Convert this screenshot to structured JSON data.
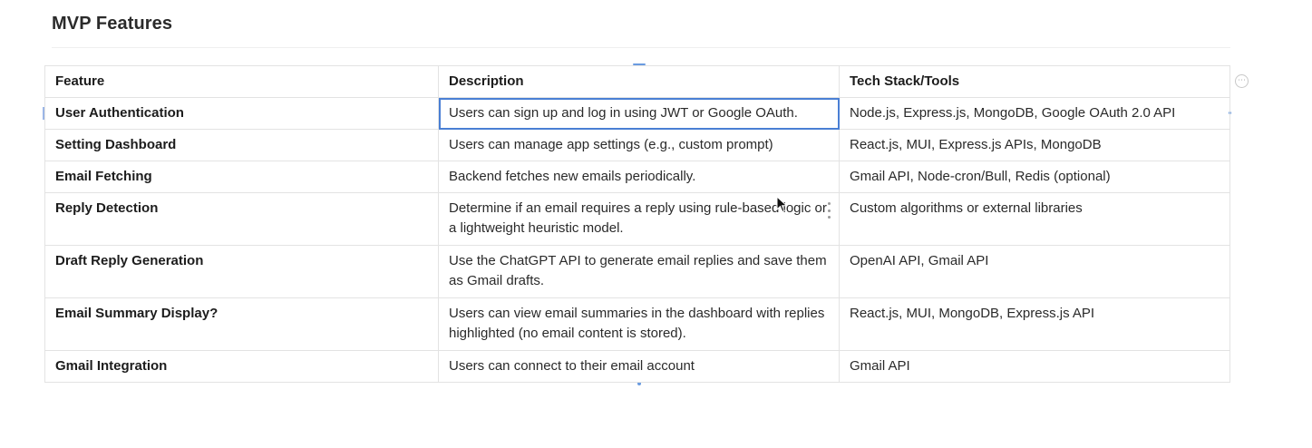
{
  "page": {
    "title": "MVP Features"
  },
  "table": {
    "headers": {
      "feature": "Feature",
      "description": "Description",
      "tech": "Tech Stack/Tools"
    },
    "rows": [
      {
        "feature": "User Authentication",
        "description": "Users can sign up and log in using JWT or Google OAuth.",
        "tech": "Node.js, Express.js, MongoDB, Google OAuth 2.0 API"
      },
      {
        "feature": "Setting Dashboard",
        "description": "Users can manage app settings (e.g., custom prompt)",
        "tech": "React.js, MUI, Express.js APIs, MongoDB"
      },
      {
        "feature": "Email Fetching",
        "description": "Backend fetches new emails periodically.",
        "tech": "Gmail API, Node-cron/Bull, Redis (optional)"
      },
      {
        "feature": "Reply Detection",
        "description": "Determine if an email requires a reply using rule-based logic or a lightweight heuristic model.",
        "tech": "Custom algorithms or external libraries"
      },
      {
        "feature": "Draft Reply Generation",
        "description": "Use the ChatGPT API to generate email replies and save them as Gmail drafts.",
        "tech": "OpenAI API, Gmail API"
      },
      {
        "feature": "Email Summary Display?",
        "description": "Users can view email summaries in the dashboard with replies highlighted (no email content is stored).",
        "tech": "React.js, MUI, MongoDB, Express.js API"
      },
      {
        "feature": "Gmail Integration",
        "description": "Users can connect to their email account",
        "tech": "Gmail API"
      }
    ]
  },
  "icons": {
    "table_options": "more-options-icon",
    "row_menu": "vertical-dots-icon",
    "cursor": "mouse-pointer-icon"
  },
  "colors": {
    "selection": "#4a7fd4",
    "border": "#e3e3e3"
  }
}
